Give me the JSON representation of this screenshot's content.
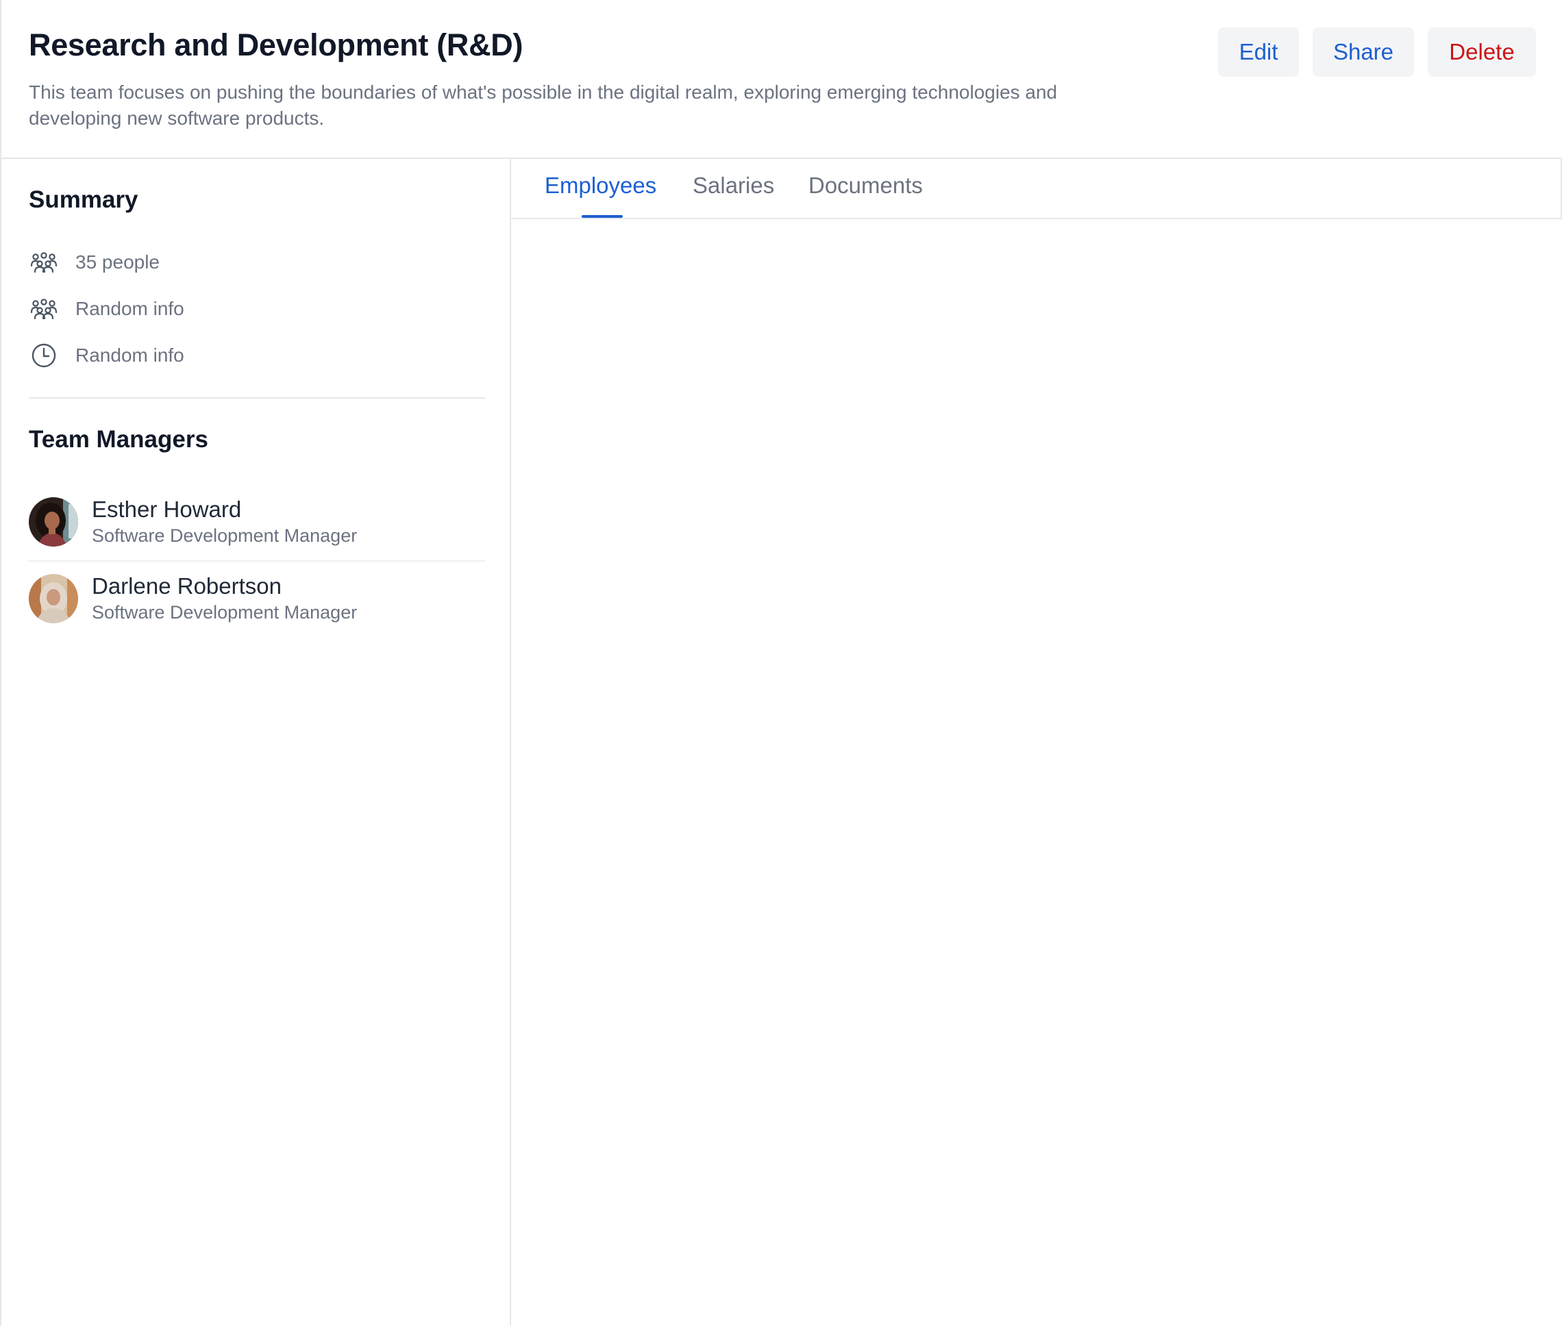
{
  "header": {
    "title": "Research and Development (R&D)",
    "description": "This team focuses on pushing the boundaries of what's possible in the digital realm, exploring emerging technologies and developing new software products.",
    "actions": {
      "edit_label": "Edit",
      "share_label": "Share",
      "delete_label": "Delete"
    }
  },
  "summary": {
    "title": "Summary",
    "items": [
      {
        "icon": "users-group-icon",
        "label": "35 people"
      },
      {
        "icon": "users-group-icon",
        "label": "Random info"
      },
      {
        "icon": "clock-icon",
        "label": "Random info"
      }
    ]
  },
  "managers": {
    "title": "Team Managers",
    "list": [
      {
        "name": "Esther Howard",
        "role": "Software Development Manager"
      },
      {
        "name": "Darlene Robertson",
        "role": "Software Development Manager"
      }
    ]
  },
  "tabs": {
    "items": [
      {
        "label": "Employees",
        "active": true
      },
      {
        "label": "Salaries",
        "active": false
      },
      {
        "label": "Documents",
        "active": false
      }
    ]
  },
  "colors": {
    "accent": "#1d5fd1",
    "danger": "#cc1414",
    "text_primary": "#111827",
    "text_secondary": "#6b7280",
    "border": "#e5e7eb",
    "button_bg": "#f3f4f6"
  }
}
